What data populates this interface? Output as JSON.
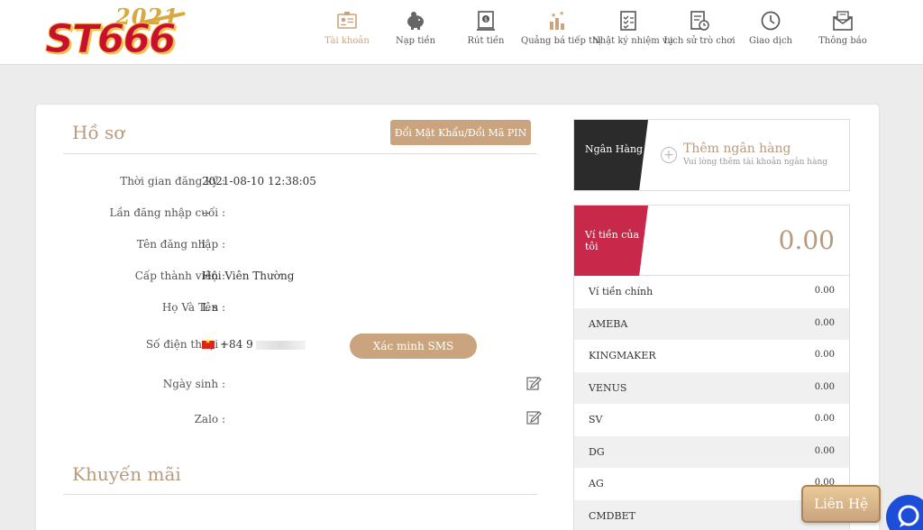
{
  "brand": {
    "year": "2021",
    "name": "ST666"
  },
  "nav": [
    {
      "label": "Tài khoản",
      "icon": "id-card-icon",
      "active": true
    },
    {
      "label": "Nạp tiền",
      "icon": "piggy-bank-icon",
      "active": false
    },
    {
      "label": "Rút tiền",
      "icon": "withdraw-icon",
      "active": false
    },
    {
      "label": "Quảng bá tiếp thị",
      "icon": "promotion-icon",
      "active": false
    },
    {
      "label": "Nhật ký nhiệm vụ",
      "icon": "checklist-icon",
      "active": false
    },
    {
      "label": "Lịch sử trò chơi",
      "icon": "history-icon",
      "active": false
    },
    {
      "label": "Giao dịch",
      "icon": "clock-icon",
      "active": false
    },
    {
      "label": "Thông báo",
      "icon": "envelope-icon",
      "active": false
    }
  ],
  "profile": {
    "title": "Hồ sơ",
    "change_pin_label": "Đổi Mật Khẩu/Đổi Mã PIN",
    "rows": [
      {
        "label": "Thời gian đăng ký :",
        "value": "2021-08-10 12:38:05"
      },
      {
        "label": "Lần đăng nhập cuối :",
        "value": "--"
      },
      {
        "label": "Tên đăng nhập :",
        "value": "l"
      },
      {
        "label": "Cấp thành viên :",
        "value": "Hội Viên Thường"
      },
      {
        "label": "Họ Và Tên :",
        "value": "L    s"
      },
      {
        "label": "Số điện thoại :",
        "value": "+84  9"
      },
      {
        "label": "Ngày sinh :",
        "value": ""
      },
      {
        "label": "Zalo :",
        "value": ""
      }
    ],
    "sms_label": "Xác minh SMS"
  },
  "promotions": {
    "title": "Khuyến mãi"
  },
  "bank": {
    "tag": "Ngân Hàng",
    "add_title": "Thêm ngân hàng",
    "add_subtitle": "Vui lòng thêm tài khoản ngân hàng"
  },
  "wallet": {
    "tag": "Ví tiền của tôi",
    "total": "0.00",
    "items": [
      {
        "name": "Ví tiền chính",
        "value": "0.00"
      },
      {
        "name": "AMEBA",
        "value": "0.00"
      },
      {
        "name": "KINGMAKER",
        "value": "0.00"
      },
      {
        "name": "VENUS",
        "value": "0.00"
      },
      {
        "name": "SV",
        "value": "0.00"
      },
      {
        "name": "DG",
        "value": "0.00"
      },
      {
        "name": "AG",
        "value": "0.00"
      },
      {
        "name": "CMDBET",
        "value": ""
      }
    ]
  },
  "contact_label": "Liên Hệ",
  "colors": {
    "accent": "#c9a47e",
    "wallet": "#c8284a",
    "bank": "#2b2b2b",
    "chat": "#1d4ed8"
  }
}
